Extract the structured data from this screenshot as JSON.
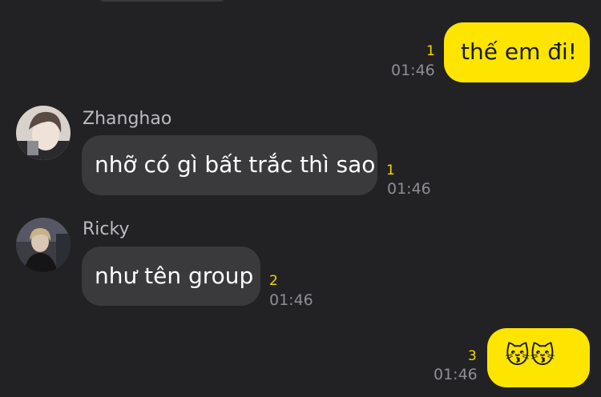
{
  "messages": [
    {
      "direction": "outgoing",
      "text": "thế em đi!",
      "unread": "1",
      "time": "01:46"
    },
    {
      "direction": "incoming",
      "sender": "Zhanghao",
      "text": "nhỡ có gì bất trắc thì sao",
      "unread": "1",
      "time": "01:46"
    },
    {
      "direction": "incoming",
      "sender": "Ricky",
      "text": "như tên group",
      "unread": "2",
      "time": "01:46"
    },
    {
      "direction": "outgoing",
      "text": "😽😽",
      "unread": "3",
      "time": "01:46"
    }
  ],
  "colors": {
    "background": "#222224",
    "outgoing_bubble": "#fee500",
    "incoming_bubble": "#3a3a3c",
    "unread_count": "#f6d800",
    "timestamp": "#8e8e93",
    "sender_name": "#bcbcc0"
  }
}
